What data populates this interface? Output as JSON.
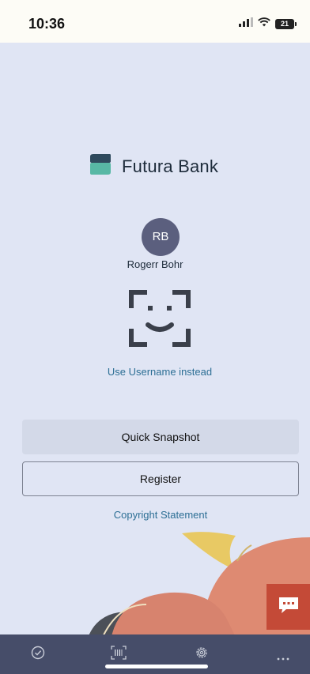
{
  "status_bar": {
    "time": "10:36",
    "battery_level": "21",
    "icons": [
      "signal-icon",
      "wifi-icon",
      "battery-icon"
    ]
  },
  "brand": {
    "name": "Futura Bank",
    "logo_icon": "futura-bank-logo-icon"
  },
  "user": {
    "initials": "RB",
    "name": "Rogerr Bohr"
  },
  "login": {
    "face_icon": "face-id-icon",
    "alt_link": "Use Username instead"
  },
  "actions": {
    "quick_snapshot": "Quick Snapshot",
    "register": "Register"
  },
  "footer": {
    "copyright": "Copyright Statement"
  },
  "chat": {
    "icon": "chat-bubble-icon"
  },
  "bottom_nav": {
    "items": [
      "check-circle-icon",
      "barcode-icon",
      "settings-icon",
      "more-icon"
    ]
  },
  "colors": {
    "background": "#e0e5f4",
    "link": "#2d6f95",
    "avatar": "#5b5f7e",
    "nav_bar": "#464d69",
    "chat_button": "#c44a37"
  }
}
